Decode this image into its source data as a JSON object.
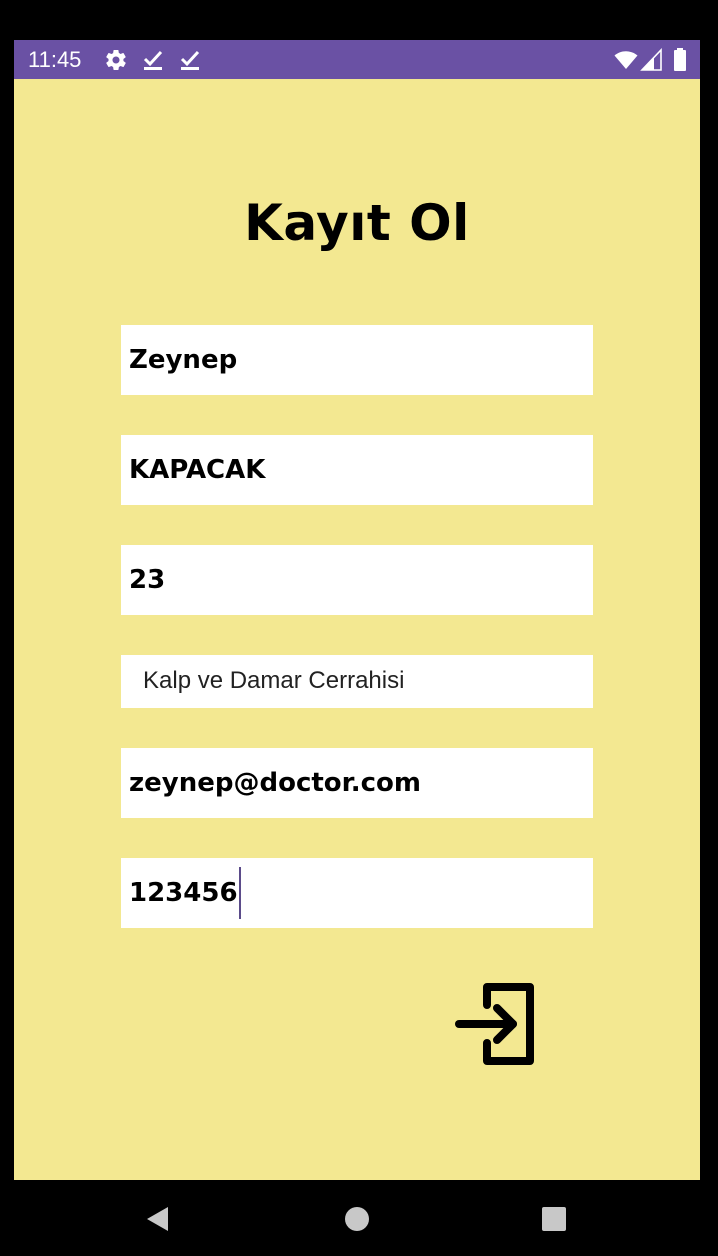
{
  "status_bar": {
    "time": "11:45",
    "background": "#6a51a4",
    "icons": [
      "gear-icon",
      "check-download-icon",
      "check-download-icon",
      "wifi-icon",
      "cell-signal-icon",
      "battery-icon"
    ]
  },
  "screen": {
    "background": "#f3e891",
    "title": "Kayıt Ol"
  },
  "form": {
    "first_name": "Zeynep",
    "last_name": "KAPACAK",
    "age": "23",
    "specialty": "Kalp ve Damar Cerrahisi",
    "email": "zeynep@doctor.com",
    "password": "123456",
    "submit_icon": "login-enter-icon"
  },
  "nav_bar": {
    "icons": [
      "back-triangle-icon",
      "home-circle-icon",
      "recents-square-icon"
    ]
  }
}
